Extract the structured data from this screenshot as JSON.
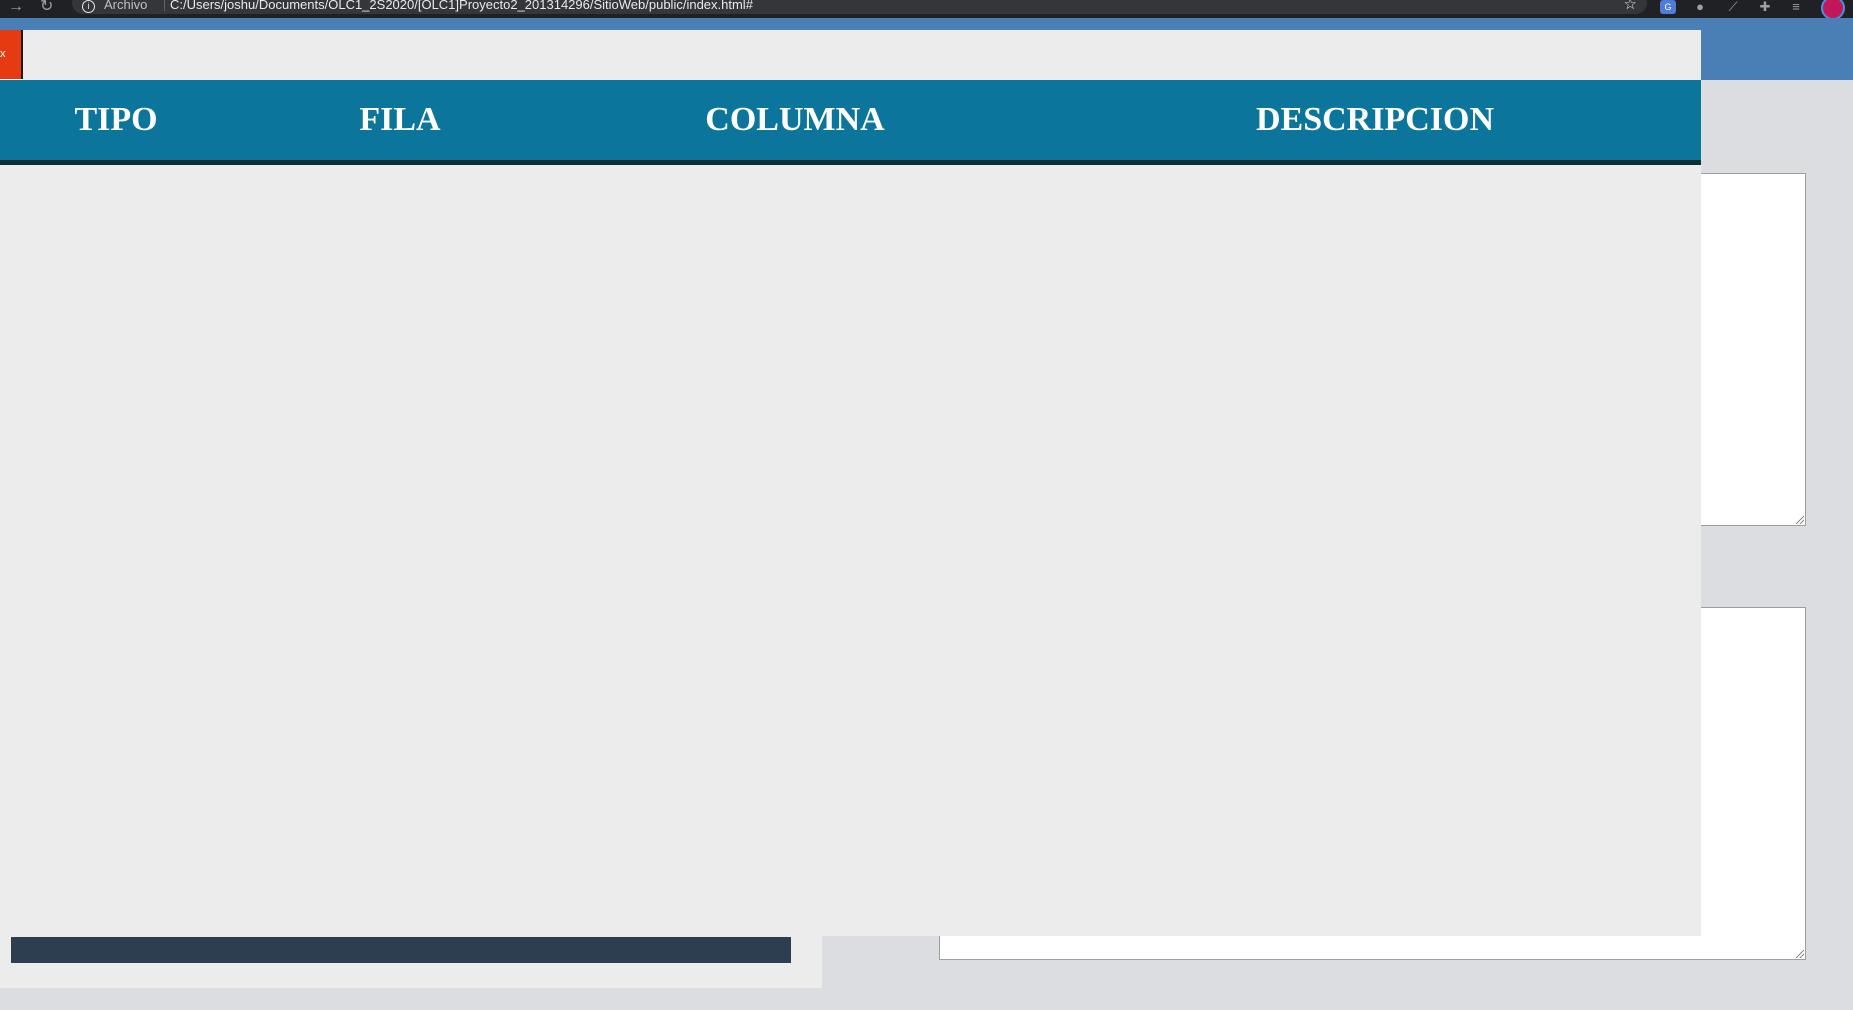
{
  "browser": {
    "scheme_label": "Archivo",
    "url": "C:/Users/joshu/Documents/OLC1_2S2020/[OLC1]Proyecto2_201314296/SitioWeb/public/index.html#",
    "back_icon": "back-arrow-icon",
    "reload_icon": "reload-icon",
    "star_icon": "star-icon"
  },
  "modal": {
    "close_label": "x",
    "table": {
      "columns": [
        "TIPO",
        "FILA",
        "COLUMNA",
        "DESCRIPCION"
      ],
      "rows": []
    }
  },
  "colors": {
    "header_blue": "#4a7fb5",
    "table_header": "#0b759c",
    "close_button": "#e53a12",
    "overlay_bg": "#ececec",
    "progress_bar": "#2c3e50"
  }
}
